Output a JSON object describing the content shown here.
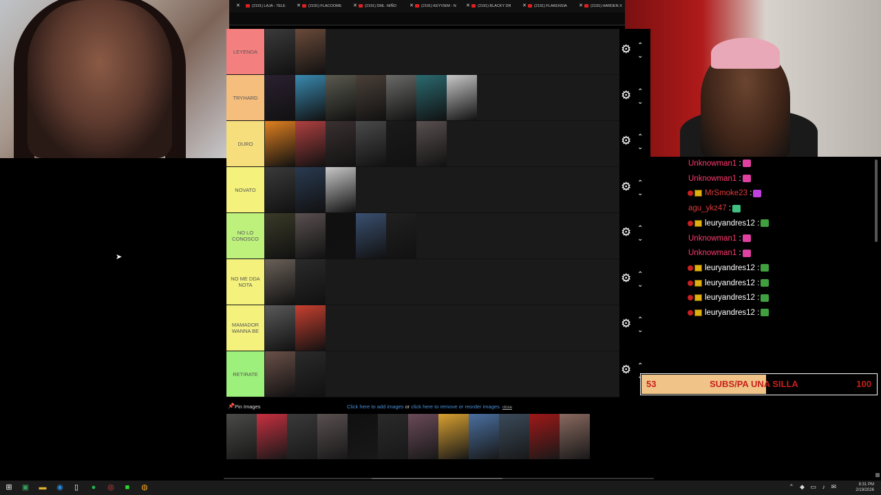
{
  "browser_tabs": [
    {
      "label": "(2191) LAJA - 7ELE"
    },
    {
      "label": "(2191) FLACOOME"
    },
    {
      "label": "(2191) DML -NIÑO"
    },
    {
      "label": "(2191) KEYVIEM - N"
    },
    {
      "label": "(2191) BLACKY DR"
    },
    {
      "label": "(2191) FLAKENSIA"
    },
    {
      "label": "(2191) HARDEN X"
    }
  ],
  "tiers": [
    {
      "label": "LEYENDA",
      "color": "#f47f7f",
      "items": [
        "#3a3a3a",
        "#6a4a3a"
      ]
    },
    {
      "label": "TRYHARD",
      "color": "#f5be7d",
      "items": [
        "#2a2030",
        "#3a8ab0",
        "#5a5a50",
        "#4a4038",
        "#6a6a68",
        "#2a6a70",
        "#c8c8c8"
      ]
    },
    {
      "label": "DURO",
      "color": "#f6de7c",
      "items": [
        "#e08020",
        "#b04040",
        "#3a3030",
        "#4a4a4a",
        "#1a1a1a",
        "#5a5050"
      ]
    },
    {
      "label": "NOVATO",
      "color": "#f4f27c",
      "items": [
        "#3a3a3a",
        "#2a3a50",
        "#c8c8c8"
      ]
    },
    {
      "label": "NO LO CONOSCO",
      "color": "#bef07c",
      "items": [
        "#3a3a28",
        "#5a5050",
        "#101010",
        "#3a5070",
        "#202020"
      ]
    },
    {
      "label": "NO ME DDA NOTA",
      "color": "#f4f27c",
      "items": [
        "#6a6058",
        "#2a2a2a"
      ]
    },
    {
      "label": "MAMADOR WANNA BE",
      "color": "#f4f27c",
      "items": [
        "#5a5a5a",
        "#c84030"
      ]
    },
    {
      "label": "RETIRATE",
      "color": "#9ef07c",
      "items": [
        "#6a5048",
        "#2a2a2a"
      ]
    }
  ],
  "chat": [
    {
      "user": "Unknowman1",
      "sep": ":",
      "color": "#ff3b6e",
      "dot": false,
      "badge": false,
      "emote": "#e040a0"
    },
    {
      "user": "Unknowman1",
      "sep": ":",
      "color": "#ff3b6e",
      "dot": false,
      "badge": false,
      "emote": "#e040a0"
    },
    {
      "user": "MrSmoke23",
      "sep": ":",
      "color": "#e03a3a",
      "dot": true,
      "badge": true,
      "emote": "#c040e0"
    },
    {
      "user": "agu_ykz47",
      "sep": ":",
      "color": "#e03a3a",
      "dot": false,
      "badge": false,
      "emote": "#40c080"
    },
    {
      "user": "leuryandres12",
      "sep": ":",
      "color": "#ffffff",
      "dot": true,
      "badge": true,
      "emote": "#40a040"
    },
    {
      "user": "Unknowman1",
      "sep": ":",
      "color": "#ff3b6e",
      "dot": false,
      "badge": false,
      "emote": "#e040a0"
    },
    {
      "user": "Unknowman1",
      "sep": ":",
      "color": "#ff3b6e",
      "dot": false,
      "badge": false,
      "emote": "#e040a0"
    },
    {
      "user": "leuryandres12",
      "sep": ":",
      "color": "#ffffff",
      "dot": true,
      "badge": true,
      "emote": "#40a040"
    },
    {
      "user": "leuryandres12",
      "sep": ":",
      "color": "#ffffff",
      "dot": true,
      "badge": true,
      "emote": "#40a040"
    },
    {
      "user": "leuryandres12",
      "sep": ":",
      "color": "#ffffff",
      "dot": true,
      "badge": true,
      "emote": "#40a040"
    },
    {
      "user": "leuryandres12",
      "sep": ":",
      "color": "#ffffff",
      "dot": true,
      "badge": true,
      "emote": "#40a040"
    }
  ],
  "goal": {
    "current": "53",
    "title": "SUBS/PA UNA SILLA",
    "target": "100",
    "progress": 0.53
  },
  "pin": {
    "title": "Pin Images",
    "link_add": "Click here to add images",
    "or": "or",
    "link_remove": "click here to remove or reorder images.",
    "close": "close",
    "images": [
      "#4a4a48",
      "#c83040",
      "#3a3a3a",
      "#5a5050",
      "#101010",
      "#2a2a2a",
      "#6a4a58",
      "#d8a030",
      "#4a70a0",
      "#3a4a5a",
      "#a01818",
      "#8a6a60"
    ]
  },
  "taskbar": {
    "time": "8:31 PM",
    "date": "2/19/2026"
  }
}
